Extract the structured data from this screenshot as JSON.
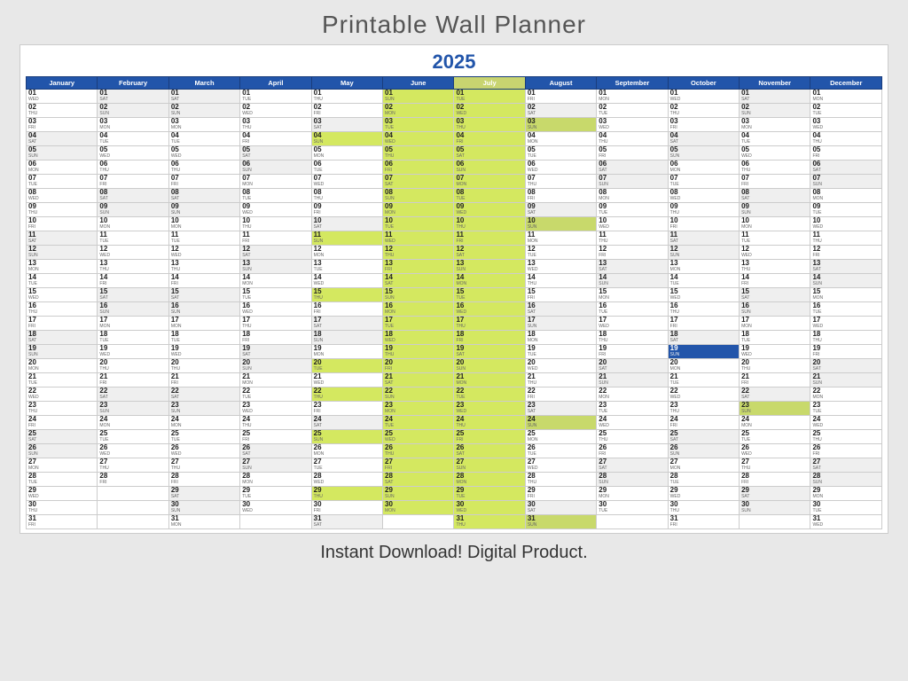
{
  "title": "Printable Wall Planner",
  "year": "2025",
  "subtitle": "Instant Download!  Digital Product.",
  "months": [
    "January",
    "February",
    "March",
    "April",
    "May",
    "June",
    "July",
    "August",
    "September",
    "October",
    "November",
    "December"
  ],
  "days": {
    "January": [
      "WED",
      "THU",
      "FRI",
      "SAT",
      "SUN",
      "MON",
      "TUE",
      "WED",
      "THU",
      "FRI",
      "SAT",
      "SUN",
      "MON",
      "TUE",
      "WED",
      "THU",
      "FRI",
      "SAT",
      "SUN",
      "MON",
      "TUE",
      "WED",
      "THU",
      "FRI",
      "SAT",
      "SUN",
      "MON",
      "TUE",
      "WED",
      "THU",
      "FRI"
    ],
    "February": [
      "SAT",
      "SUN",
      "MON",
      "TUE",
      "WED",
      "THU",
      "FRI",
      "SAT",
      "SUN",
      "MON",
      "TUE",
      "WED",
      "THU",
      "FRI",
      "SAT",
      "SUN",
      "MON",
      "TUE",
      "WED",
      "THU",
      "FRI",
      "SAT",
      "SUN",
      "MON",
      "TUE",
      "WED",
      "THU",
      "FRI",
      "",
      "",
      ""
    ],
    "March": [
      "SAT",
      "SUN",
      "MON",
      "TUE",
      "WED",
      "THU",
      "FRI",
      "SAT",
      "SUN",
      "MON",
      "TUE",
      "WED",
      "THU",
      "FRI",
      "SAT",
      "SUN",
      "MON",
      "TUE",
      "WED",
      "THU",
      "FRI",
      "SAT",
      "SUN",
      "MON",
      "TUE",
      "WED",
      "THU",
      "FRI",
      "SAT",
      "SUN",
      "MON"
    ],
    "April": [
      "TUE",
      "WED",
      "THU",
      "FRI",
      "SAT",
      "SUN",
      "MON",
      "TUE",
      "WED",
      "THU",
      "FRI",
      "SAT",
      "SUN",
      "MON",
      "TUE",
      "WED",
      "THU",
      "FRI",
      "SAT",
      "SUN",
      "MON",
      "TUE",
      "WED",
      "THU",
      "FRI",
      "SAT",
      "SUN",
      "MON",
      "TUE",
      "WED",
      ""
    ],
    "May": [
      "THU",
      "FRI",
      "SAT",
      "SUN",
      "MON",
      "TUE",
      "WED",
      "THU",
      "FRI",
      "SAT",
      "SUN",
      "MON",
      "TUE",
      "WED",
      "THU",
      "FRI",
      "SAT",
      "SUN",
      "MON",
      "TUE",
      "WED",
      "THU",
      "FRI",
      "SAT",
      "SUN",
      "MON",
      "TUE",
      "WED",
      "THU",
      "FRI",
      "SAT"
    ],
    "June": [
      "SUN",
      "MON",
      "TUE",
      "WED",
      "THU",
      "FRI",
      "SAT",
      "SUN",
      "MON",
      "TUE",
      "WED",
      "THU",
      "FRI",
      "SAT",
      "SUN",
      "MON",
      "TUE",
      "WED",
      "THU",
      "FRI",
      "SAT",
      "SUN",
      "MON",
      "TUE",
      "WED",
      "THU",
      "FRI",
      "SAT",
      "SUN",
      "MON",
      ""
    ],
    "July": [
      "TUE",
      "WED",
      "THU",
      "FRI",
      "SAT",
      "SUN",
      "MON",
      "TUE",
      "WED",
      "THU",
      "FRI",
      "SAT",
      "SUN",
      "MON",
      "TUE",
      "WED",
      "THU",
      "FRI",
      "SAT",
      "SUN",
      "MON",
      "TUE",
      "WED",
      "THU",
      "FRI",
      "SAT",
      "SUN",
      "MON",
      "TUE",
      "WED",
      "THU"
    ],
    "August": [
      "FRI",
      "SAT",
      "SUN",
      "MON",
      "TUE",
      "WED",
      "THU",
      "FRI",
      "SAT",
      "SUN",
      "MON",
      "TUE",
      "WED",
      "THU",
      "FRI",
      "SAT",
      "SUN",
      "MON",
      "TUE",
      "WED",
      "THU",
      "FRI",
      "SAT",
      "SUN",
      "MON",
      "TUE",
      "WED",
      "THU",
      "FRI",
      "SAT",
      "SUN"
    ],
    "September": [
      "MON",
      "TUE",
      "WED",
      "THU",
      "FRI",
      "SAT",
      "SUN",
      "MON",
      "TUE",
      "WED",
      "THU",
      "FRI",
      "SAT",
      "SUN",
      "MON",
      "TUE",
      "WED",
      "THU",
      "FRI",
      "SAT",
      "SUN",
      "MON",
      "TUE",
      "WED",
      "THU",
      "FRI",
      "SAT",
      "SUN",
      "MON",
      "TUE",
      ""
    ],
    "October": [
      "WED",
      "THU",
      "FRI",
      "SAT",
      "SUN",
      "MON",
      "TUE",
      "WED",
      "THU",
      "FRI",
      "SAT",
      "SUN",
      "MON",
      "TUE",
      "WED",
      "THU",
      "FRI",
      "SAT",
      "SUN",
      "MON",
      "TUE",
      "WED",
      "THU",
      "FRI",
      "SAT",
      "SUN",
      "MON",
      "TUE",
      "WED",
      "THU",
      "FRI"
    ],
    "November": [
      "SAT",
      "SUN",
      "MON",
      "TUE",
      "WED",
      "THU",
      "FRI",
      "SAT",
      "SUN",
      "MON",
      "TUE",
      "WED",
      "THU",
      "FRI",
      "SAT",
      "SUN",
      "MON",
      "TUE",
      "WED",
      "THU",
      "FRI",
      "SAT",
      "SUN",
      "MON",
      "TUE",
      "WED",
      "THU",
      "FRI",
      "SAT",
      "SUN",
      ""
    ],
    "December": [
      "MON",
      "TUE",
      "WED",
      "THU",
      "FRI",
      "SAT",
      "SUN",
      "MON",
      "TUE",
      "WED",
      "THU",
      "FRI",
      "SAT",
      "SUN",
      "MON",
      "TUE",
      "WED",
      "THU",
      "FRI",
      "SAT",
      "SUN",
      "MON",
      "TUE",
      "WED",
      "THU",
      "FRI",
      "SAT",
      "SUN",
      "MON",
      "TUE",
      "WED"
    ]
  }
}
